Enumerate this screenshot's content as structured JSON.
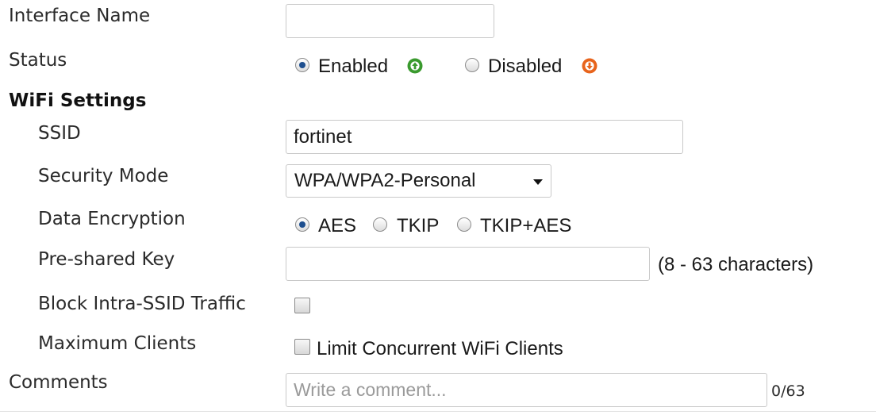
{
  "form": {
    "interface_name": {
      "label": "Interface Name",
      "value": ""
    },
    "status": {
      "label": "Status",
      "enabled_label": "Enabled",
      "disabled_label": "Disabled",
      "selected": "Enabled",
      "enabled_icon": "arrow-up-circle-icon",
      "disabled_icon": "arrow-down-circle-icon",
      "enabled_color": "#3a9a2e",
      "disabled_color": "#e8641c"
    },
    "wifi_settings": {
      "heading": "WiFi Settings",
      "ssid": {
        "label": "SSID",
        "value": "fortinet"
      },
      "security_mode": {
        "label": "Security Mode",
        "value": "WPA/WPA2-Personal"
      },
      "data_encryption": {
        "label": "Data Encryption",
        "options": [
          "AES",
          "TKIP",
          "TKIP+AES"
        ],
        "selected": "AES"
      },
      "pre_shared_key": {
        "label": "Pre-shared Key",
        "value": "",
        "hint": "(8 - 63 characters)"
      },
      "block_intra_ssid": {
        "label": "Block Intra-SSID Traffic",
        "checked": false
      },
      "maximum_clients": {
        "label": "Maximum Clients",
        "checkbox_label": "Limit Concurrent WiFi Clients",
        "checked": false
      }
    },
    "comments": {
      "label": "Comments",
      "placeholder": "Write a comment...",
      "counter": "0/63"
    }
  }
}
